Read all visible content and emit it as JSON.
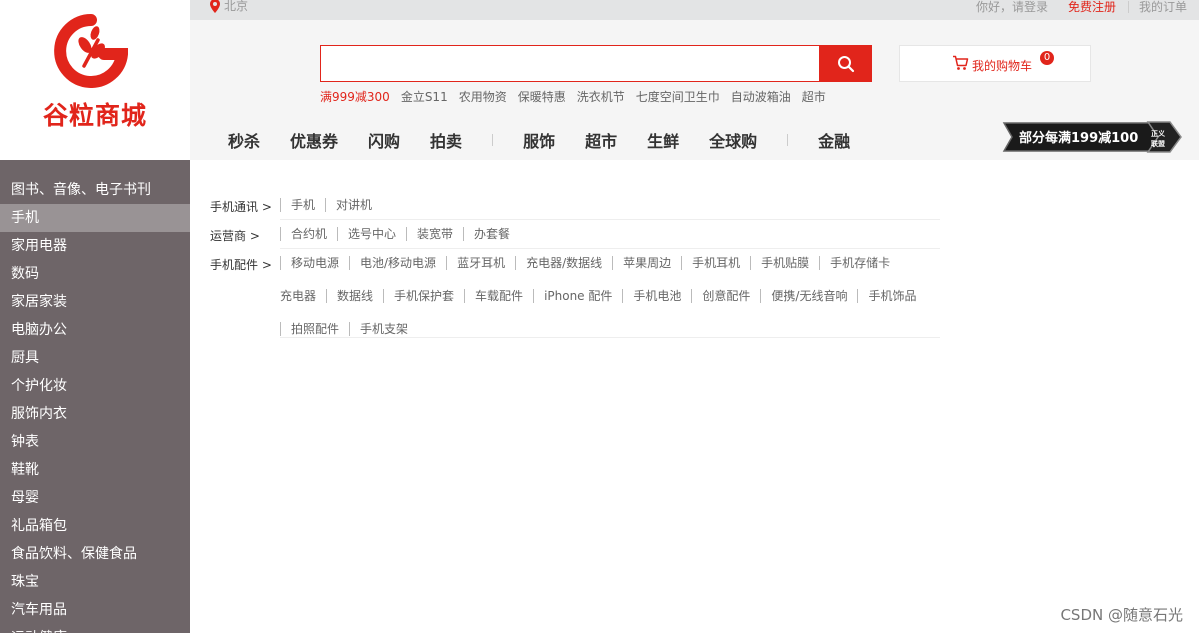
{
  "logo": {
    "text": "谷粒商城"
  },
  "topbar": {
    "location": "北京",
    "greeting": "你好，请登录",
    "register": "免费注册",
    "orders": "我的订单"
  },
  "search": {
    "value": "",
    "placeholder": ""
  },
  "cart": {
    "label": "我的购物车",
    "count": "0"
  },
  "hotwords": [
    "满999减300",
    "金立S11",
    "农用物资",
    "保暖特惠",
    "洗衣机节",
    "七度空间卫生巾",
    "自动波箱油",
    "超市"
  ],
  "nav": {
    "items": [
      "秒杀",
      "优惠券",
      "闪购",
      "拍卖",
      "服饰",
      "超市",
      "生鲜",
      "全球购",
      "金融"
    ]
  },
  "promo": {
    "text": "部分每满199减100",
    "badge": "正义联盟"
  },
  "categories": [
    "图书、音像、电子书刊",
    "手机",
    "家用电器",
    "数码",
    "家居家装",
    "电脑办公",
    "厨具",
    "个护化妆",
    "服饰内衣",
    "钟表",
    "鞋靴",
    "母婴",
    "礼品箱包",
    "食品饮料、保健食品",
    "珠宝",
    "汽车用品",
    "运动健康"
  ],
  "active_category": "手机",
  "subcategories": [
    {
      "title": "手机通讯 >",
      "items": [
        "手机",
        "对讲机"
      ]
    },
    {
      "title": "运营商 >",
      "items": [
        "合约机",
        "选号中心",
        "装宽带",
        "办套餐"
      ]
    },
    {
      "title": "手机配件 >",
      "items": [
        "移动电源",
        "电池/移动电源",
        "蓝牙耳机",
        "充电器/数据线",
        "苹果周边",
        "手机耳机",
        "手机贴膜",
        "手机存储卡",
        "充电器",
        "数据线",
        "手机保护套",
        "车载配件",
        "iPhone 配件",
        "手机电池",
        "创意配件",
        "便携/无线音响",
        "手机饰品",
        "拍照配件",
        "手机支架"
      ]
    }
  ],
  "watermark": "CSDN @随意石光",
  "colors": {
    "brand_red": "#e1251b",
    "sidebar_bg": "#6e6568",
    "sidebar_active": "#999395"
  }
}
